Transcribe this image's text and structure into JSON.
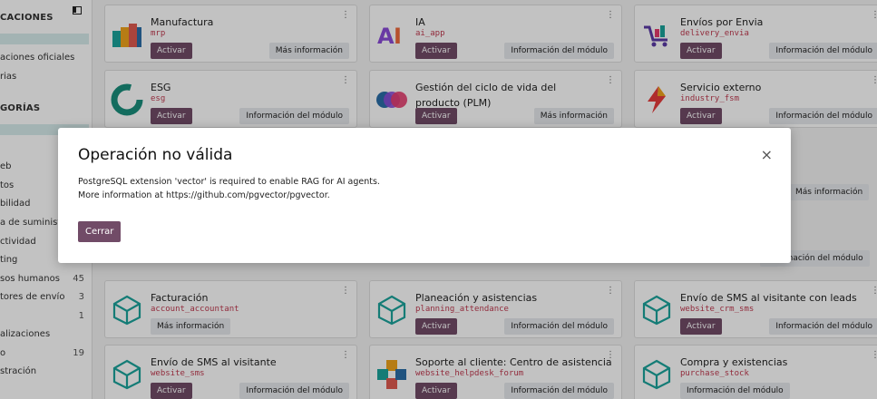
{
  "sidebar": {
    "head1": "CACIONES",
    "item_a": "aciones oficiales",
    "item_b": "rias",
    "head2": "GORÍAS",
    "cats": [
      {
        "label": "eb",
        "count": ""
      },
      {
        "label": "tos",
        "count": ""
      },
      {
        "label": "bilidad",
        "count": ""
      },
      {
        "label": "a de suministr",
        "count": ""
      },
      {
        "label": "ctividad",
        "count": ""
      },
      {
        "label": "ting",
        "count": ""
      },
      {
        "label": "sos humanos",
        "count": "45"
      },
      {
        "label": "tores de envío",
        "count": "3"
      },
      {
        "label": "",
        "count": "1"
      },
      {
        "label": "alizaciones",
        "count": ""
      },
      {
        "label": "o",
        "count": "19"
      },
      {
        "label": "stración",
        "count": ""
      }
    ]
  },
  "modules": [
    {
      "name": "Manufactura",
      "tech": "mrp",
      "activate": "Activar",
      "info": "Más información"
    },
    {
      "name": "IA",
      "tech": "ai_app",
      "activate": "Activar",
      "info": "Información del módulo"
    },
    {
      "name": "Envíos por Envia",
      "tech": "delivery_envia",
      "activate": "Activar",
      "info": "Información del módulo"
    },
    {
      "name": "ESG",
      "tech": "esg",
      "activate": "Activar",
      "info": "Información del módulo"
    },
    {
      "name": "Gestión del ciclo de vida del producto (PLM)",
      "tech": "mrp_plm",
      "activate": "Activar",
      "info": "Más información"
    },
    {
      "name": "Servicio externo",
      "tech": "industry_fsm",
      "activate": "Activar",
      "info": "Información del módulo"
    },
    {
      "name": "Facturación",
      "tech": "account_accountant",
      "activate": "",
      "info": "Más información"
    },
    {
      "name": "Planeación y asistencias",
      "tech": "planning_attendance",
      "activate": "Activar",
      "info": "Información del módulo"
    },
    {
      "name": "Envío de SMS al visitante con leads",
      "tech": "website_crm_sms",
      "activate": "Activar",
      "info": "Información del módulo"
    },
    {
      "name": "Envío de SMS al visitante",
      "tech": "website_sms",
      "activate": "Activar",
      "info": "Información del módulo"
    },
    {
      "name": "Soporte al cliente: Centro de asistencia",
      "tech": "website_helpdesk_forum",
      "activate": "Activar",
      "info": "Información del módulo"
    },
    {
      "name": "Compra y existencias",
      "tech": "purchase_stock",
      "activate": "",
      "info": "Información del módulo"
    }
  ],
  "behind_buttons": {
    "r3c3_info": "Más información",
    "r4c3_info": "Información del módulo"
  },
  "modal": {
    "title": "Operación no válida",
    "line1": "PostgreSQL extension 'vector' is required to enable RAG for AI agents.",
    "line2": "More information at https://github.com/pgvector/pgvector.",
    "close_button": "Cerrar",
    "close_icon": "×"
  },
  "colors": {
    "primary": "#714b67",
    "technical_name": "#c03a50",
    "sidebar_active": "#d6ecec"
  }
}
